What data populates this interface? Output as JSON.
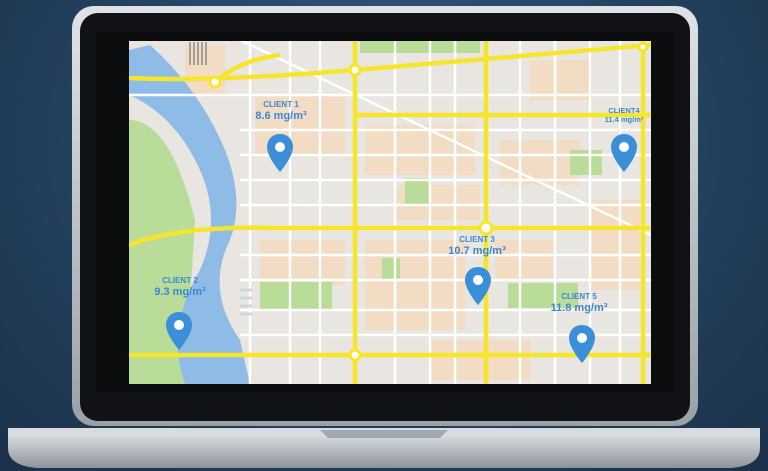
{
  "colors": {
    "background": "#2b4b6e",
    "laptop_body": "#c7ccd2",
    "bezel": "#0f1114",
    "map_ground": "#e9e6e1",
    "river": "#8fbce7",
    "park": "#b9dc98",
    "block": "#f2dcc3",
    "major_road": "#f6e62a",
    "minor_road": "#ffffff",
    "pin": "#3b8fd8",
    "label": "#3c87d3"
  },
  "markers": [
    {
      "name": "CLIENT 1",
      "value": "8.6 mg/m³",
      "icon": "map-pin-icon"
    },
    {
      "name": "CLIENT 2",
      "value": "9.3 mg/m³",
      "icon": "map-pin-icon"
    },
    {
      "name": "CLIENT 3",
      "value": "10.7 mg/m³",
      "icon": "map-pin-icon"
    },
    {
      "name": "CLIENT4",
      "value": "11.4 mg/m³",
      "icon": "map-pin-icon"
    },
    {
      "name": "CLIENT 5",
      "value": "11.8 mg/m³",
      "icon": "map-pin-icon"
    }
  ]
}
